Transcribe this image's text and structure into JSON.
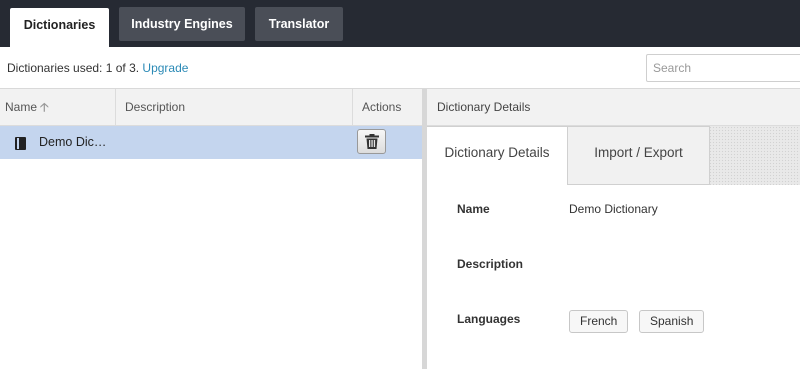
{
  "top_tabs": [
    {
      "label": "Dictionaries",
      "active": true
    },
    {
      "label": "Industry Engines",
      "active": false
    },
    {
      "label": "Translator",
      "active": false
    }
  ],
  "usage": {
    "prefix": "Dictionaries used: 1 of 3. ",
    "upgrade_link": "Upgrade"
  },
  "search": {
    "placeholder": "Search",
    "value": ""
  },
  "table": {
    "columns": {
      "name": "Name",
      "description": "Description",
      "actions": "Actions"
    },
    "sort_icon": "arrow-up-icon",
    "rows": [
      {
        "name": "Demo Dic…",
        "description": "",
        "icon": "book-icon",
        "action_icon": "trash-icon",
        "selected": true
      }
    ]
  },
  "details": {
    "header": "Dictionary Details",
    "tabs": [
      {
        "label": "Dictionary Details",
        "active": true
      },
      {
        "label": "Import / Export",
        "active": false
      }
    ],
    "fields": {
      "name_label": "Name",
      "name_value": "Demo Dictionary",
      "description_label": "Description",
      "description_value": "",
      "languages_label": "Languages"
    },
    "languages": [
      "French",
      "Spanish"
    ]
  },
  "colors": {
    "topbar_bg": "#262a33",
    "selected_row": "#c4d5ee",
    "link": "#2b8ab6"
  }
}
